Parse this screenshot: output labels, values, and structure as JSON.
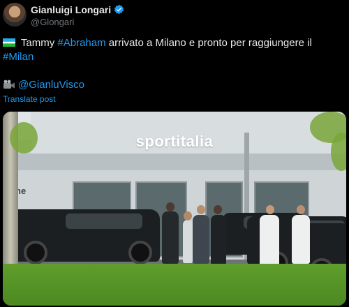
{
  "author": {
    "name": "Gianluigi Longari",
    "handle": "@Glongari"
  },
  "tweet": {
    "line1_text": " Tammy ",
    "hashtag1": "#Abraham",
    "line1_rest": " arrivato a Milano e pronto per raggiungere il",
    "hashtag2": "#Milan",
    "mention": "@GianluVisco"
  },
  "translate_label": "Translate post",
  "media": {
    "watermark": "sportitalia",
    "building_sign": "ne"
  },
  "colors": {
    "background": "#000000",
    "link": "#1d9bf0",
    "verified": "#1d9bf0"
  },
  "icons": {
    "verified": "verified-badge-icon",
    "flag": "uzbekistan-flag-icon",
    "camera": "video-camera-icon"
  }
}
